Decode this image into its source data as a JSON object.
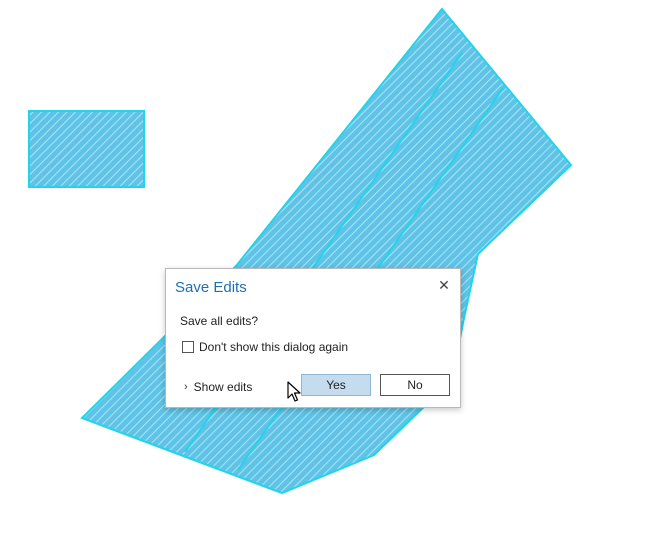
{
  "dialog": {
    "title": "Save Edits",
    "close_glyph": "✕",
    "message": "Save all edits?",
    "dont_show_label": "Don't show this dialog again",
    "dont_show_checked": false,
    "show_edits_chevron": "›",
    "show_edits_label": "Show edits",
    "yes_label": "Yes",
    "no_label": "No"
  },
  "map": {
    "features": [
      "rectangle-polygon",
      "large-polygon"
    ],
    "fill_color": "#5ec3e6",
    "hatch_color": "#a9e1f3",
    "outline_color": "#22d4ea"
  },
  "icons": {
    "close": "close-icon",
    "chevron": "chevron-right-icon",
    "cursor": "mouse-pointer-icon"
  }
}
